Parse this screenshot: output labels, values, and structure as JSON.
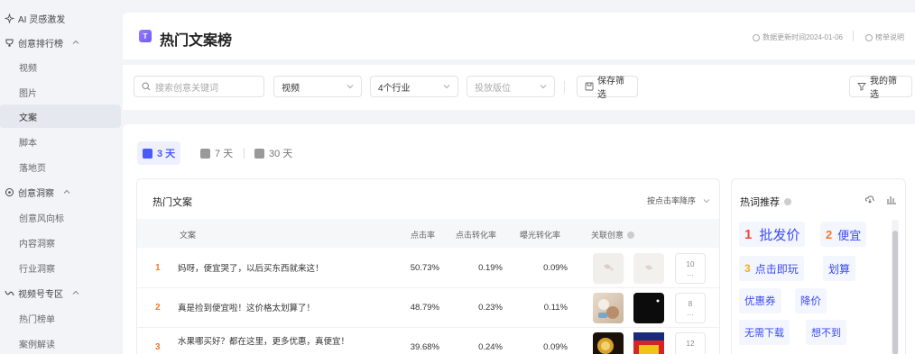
{
  "sidebar": {
    "items": [
      {
        "label": "AI 灵感激发",
        "type": "group",
        "icon": "sparkle-icon"
      },
      {
        "label": "创意排行榜",
        "type": "group",
        "icon": "trophy-icon"
      },
      {
        "label": "视频",
        "type": "sub"
      },
      {
        "label": "图片",
        "type": "sub"
      },
      {
        "label": "文案",
        "type": "sub",
        "active": true
      },
      {
        "label": "脚本",
        "type": "sub"
      },
      {
        "label": "落地页",
        "type": "sub"
      },
      {
        "label": "创意洞察",
        "type": "group",
        "icon": "insight-icon"
      },
      {
        "label": "创意风向标",
        "type": "sub"
      },
      {
        "label": "内容洞察",
        "type": "sub"
      },
      {
        "label": "行业洞察",
        "type": "sub"
      },
      {
        "label": "视频号专区",
        "type": "group",
        "icon": "channels-icon"
      },
      {
        "label": "热门榜单",
        "type": "sub"
      },
      {
        "label": "案例解读",
        "type": "sub"
      }
    ]
  },
  "header": {
    "logo_text": "T",
    "title": "热门文案榜",
    "update_time": "数据更新时间2024-01-06",
    "rules_label": "榜单说明"
  },
  "filters": {
    "search_placeholder": "搜索创意关键词",
    "format_value": "视频",
    "industry_value": "4个行业",
    "placement_placeholder": "投放版位",
    "save_label": "保存筛选",
    "my_filters_label": "我的筛选"
  },
  "tabs": [
    {
      "label": "3 天",
      "active": true
    },
    {
      "label": "7 天",
      "active": false
    },
    {
      "label": "30 天",
      "active": false
    }
  ],
  "table": {
    "title": "热门文案",
    "sort_label": "按点击率降序",
    "columns": [
      "文案",
      "点击率",
      "点击转化率",
      "曝光转化率",
      "关联创意"
    ],
    "rows": [
      {
        "rank": "1",
        "copy": "妈呀，便宜哭了，以后买东西就来这！",
        "ctr": "50.73%",
        "cvr": "0.19%",
        "ecvr": "0.09%",
        "more_count": "10",
        "more_dots": "···"
      },
      {
        "rank": "2",
        "copy": "真是捡到便宜啦！这价格太划算了！",
        "ctr": "48.79%",
        "cvr": "0.23%",
        "ecvr": "0.11%",
        "more_count": "8",
        "more_dots": "···"
      },
      {
        "rank": "3",
        "copy": "水果哪买好？都在这里，更多优惠，真便宜！",
        "ctr": "39.68%",
        "cvr": "0.24%",
        "ecvr": "0.09%",
        "more_count": "12",
        "more_dots": "···"
      }
    ]
  },
  "hotwords": {
    "title": "热词推荐",
    "words": [
      {
        "rank": "1",
        "word": "批发价"
      },
      {
        "rank": "2",
        "word": "便宜"
      },
      {
        "rank": "3",
        "word": "点击即玩"
      },
      {
        "rank": "",
        "word": "划算"
      },
      {
        "rank": "",
        "word": "优惠券"
      },
      {
        "rank": "",
        "word": "降价"
      },
      {
        "rank": "",
        "word": "无需下载"
      },
      {
        "rank": "",
        "word": "想不到"
      }
    ]
  },
  "colors": {
    "accent": "#4a5bf5",
    "rank": "#f07a2d",
    "hot_rank": "#f04a3a"
  }
}
